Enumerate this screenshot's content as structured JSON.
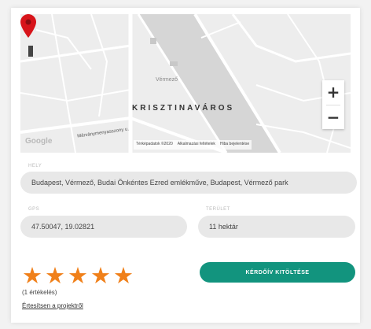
{
  "map": {
    "district_label": "KRISZTINAVÁROS",
    "place_label": "Vérmező",
    "google_logo": "Google",
    "street_label": "Márványmenyasszony u.",
    "zoom_in": "+",
    "zoom_out": "−",
    "attribution": [
      "Térképadatok ©2020",
      "Alkalmazási feltételek",
      "Hiba bejelentése"
    ],
    "pin_color": "#d7141a"
  },
  "fields": {
    "address": {
      "label": "HELY",
      "value": "Budapest, Vérmező, Budai Önkéntes Ezred emlékműve, Budapest, Vérmező park"
    },
    "gps": {
      "label": "GPS",
      "value": "47.50047, 19.02821"
    },
    "area": {
      "label": "TERÜLET",
      "value": "11 hektár"
    }
  },
  "rating": {
    "stars": 5,
    "star_color": "#f0801a",
    "count_text": "(1 értékelés)"
  },
  "notify_link": "Értesítsen a projektről",
  "cta": {
    "label": "KÉRDŐÍV KITÖLTÉSE",
    "color": "#12947e"
  }
}
